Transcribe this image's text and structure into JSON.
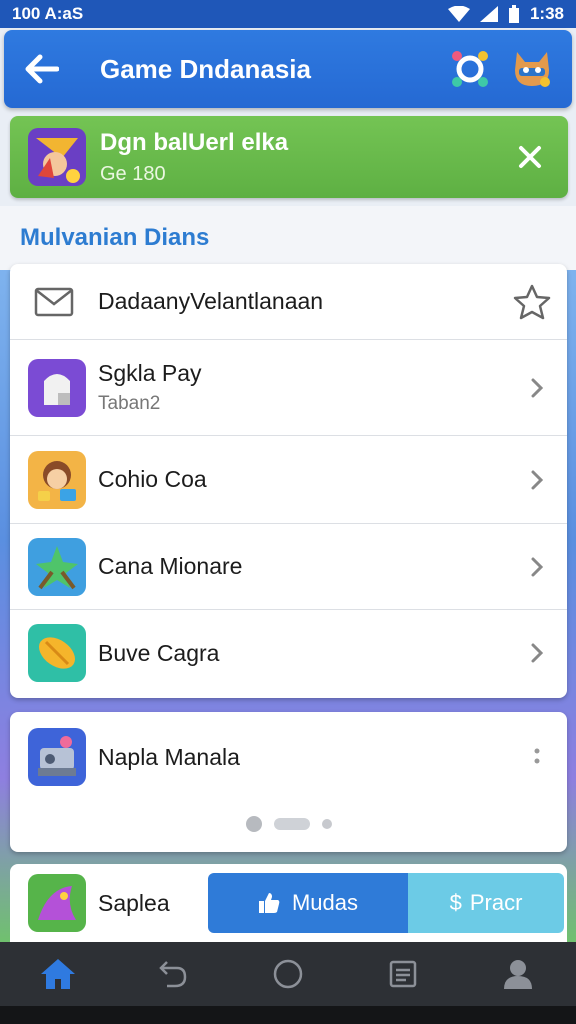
{
  "status_bar": {
    "time_left": "100 A:aS",
    "time_right": "1:38"
  },
  "app_bar": {
    "title": "Game Dndanasia"
  },
  "banner": {
    "title": "Dgn balUerl elka",
    "subtitle": "Ge 180"
  },
  "section": {
    "title": "Mulvanian Dians"
  },
  "list": {
    "header_label": "DadaanyVelantlanaan",
    "items": [
      {
        "name": "Sgkla Pay",
        "subtitle": "Taban2",
        "icon": "castle-app-icon"
      },
      {
        "name": "Cohio Coa",
        "subtitle": "",
        "icon": "character-app-icon"
      },
      {
        "name": "Cana Mionare",
        "subtitle": "",
        "icon": "star-app-icon"
      },
      {
        "name": "Buve Cagra",
        "subtitle": "",
        "icon": "gem-app-icon"
      }
    ]
  },
  "feature": {
    "name": "Napla Manala",
    "icon": "robot-app-icon"
  },
  "action_bar": {
    "name": "Saplea",
    "primary_label": "Mudas",
    "secondary_label": "Pracr",
    "secondary_symbol": "$"
  },
  "colors": {
    "primary": "#2f7ae0",
    "banner": "#66b84a",
    "accent": "#2d7cd1",
    "secondary": "#6ccbe6"
  },
  "nav": [
    "home-icon",
    "back-icon",
    "circle-home-icon",
    "recents-icon",
    "profile-icon"
  ]
}
